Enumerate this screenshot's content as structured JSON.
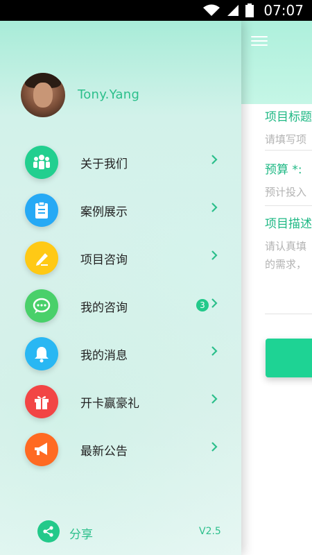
{
  "status_bar": {
    "time": "07:07"
  },
  "main": {
    "fields": [
      {
        "label": "项目标题",
        "placeholder": "请填写项"
      },
      {
        "label": "预算 *:",
        "placeholder": "预计投入"
      },
      {
        "label": "项目描述",
        "placeholder_line1": "请认真填",
        "placeholder_line2": "的需求，"
      }
    ]
  },
  "drawer": {
    "user": {
      "name": "Tony.Yang"
    },
    "menu": [
      {
        "label": "关于我们",
        "icon": "team-icon",
        "color": "#22cf8f"
      },
      {
        "label": "案例展示",
        "icon": "clipboard-icon",
        "color": "#26a9f5"
      },
      {
        "label": "项目咨询",
        "icon": "pencil-icon",
        "color": "#ffc915"
      },
      {
        "label": "我的咨询",
        "icon": "chat-icon",
        "color": "#49d06a",
        "badge": "3"
      },
      {
        "label": "我的消息",
        "icon": "bell-icon",
        "color": "#29b7f3"
      },
      {
        "label": "开卡赢豪礼",
        "icon": "gift-icon",
        "color": "#f24545"
      },
      {
        "label": "最新公告",
        "icon": "megaphone-icon",
        "color": "#ff6a22"
      }
    ],
    "footer": {
      "share_label": "分享",
      "share_icon": "share-icon",
      "version": "V2.5"
    }
  },
  "colors": {
    "accent": "#23c98a",
    "chevron": "#2cbf8b"
  }
}
